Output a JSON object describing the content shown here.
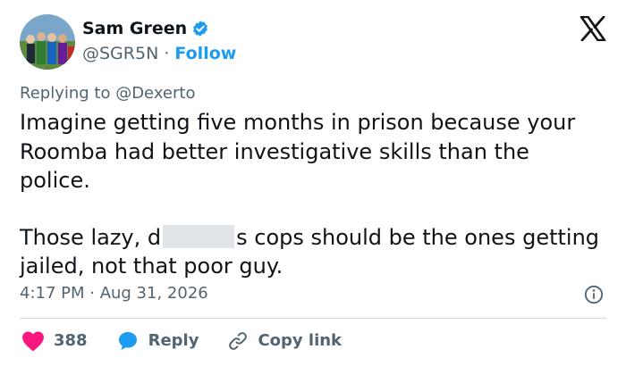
{
  "author": {
    "name": "Sam Green",
    "handle": "@SGR5N",
    "separator": " · ",
    "follow_label": "Follow",
    "verified": true
  },
  "reply_to": "Replying to @Dexerto",
  "body": {
    "paragraph1": "Imagine getting five months in prison because your Roomba had better investigative skills than the police.",
    "paragraph2_before": "Those lazy, d",
    "paragraph2_after": "s cops should be the ones getting jailed, not that poor guy."
  },
  "timestamp": "4:17 PM · Aug 31, 2026",
  "actions": {
    "like_count": "388",
    "reply_label": "Reply",
    "copy_label": "Copy link"
  },
  "icons": {
    "avatar": "avatar-photo",
    "verified": "verified-badge-icon",
    "logo": "x-logo-icon",
    "info": "info-icon",
    "like": "heart-icon",
    "reply": "reply-bubble-icon",
    "copy": "link-icon"
  },
  "colors": {
    "accent": "#1d9bf0",
    "like": "#f91880",
    "text": "#0f1419",
    "muted": "#536471",
    "divider": "#cfd9de"
  }
}
